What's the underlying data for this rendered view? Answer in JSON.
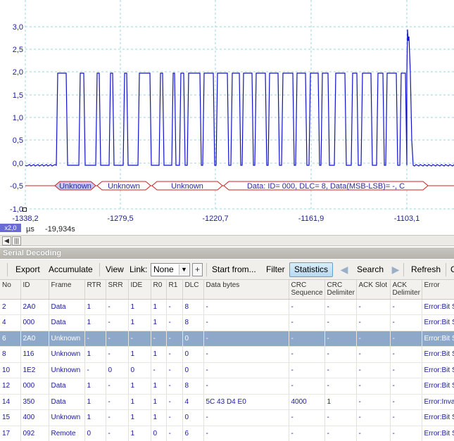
{
  "scope": {
    "y_ticks": [
      "3,0",
      "2,5",
      "2,0",
      "1,5",
      "1,0",
      "0,5",
      "0,0",
      "-0,5",
      "-1,0"
    ],
    "x_ticks": [
      "-1338,2",
      "-1279,5",
      "-1220,7",
      "-1161,9",
      "-1103,1"
    ],
    "zoom_badge": "x2,0",
    "unit": "µs",
    "time_offset": "-19,934s",
    "bus_labels": [
      "Unknown",
      "Unknown",
      "Unknown",
      "Data: ID= 000, DLC= 8, Data(MSB-LSB)= -, C"
    ],
    "colors": {
      "trace": "#1010c8",
      "grid": "#9fd4dc",
      "bus": "#d02020",
      "accent": "#6b6bd6"
    }
  },
  "panel": {
    "title": "Serial Decoding"
  },
  "toolbar": {
    "export": "Export",
    "accumulate": "Accumulate",
    "view": "View",
    "link_label": "Link:",
    "link_value": "None",
    "add": "+",
    "start_from": "Start from...",
    "filter": "Filter",
    "statistics": "Statistics",
    "search": "Search",
    "refresh": "Refresh",
    "more": "C"
  },
  "table": {
    "columns": [
      "No",
      "ID",
      "Frame",
      "RTR",
      "SRR",
      "IDE",
      "R0",
      "R1",
      "DLC",
      "Data bytes",
      "CRC Sequence",
      "CRC Delimiter",
      "ACK Slot",
      "ACK Delimiter",
      "Error"
    ],
    "rows": [
      [
        "2",
        "2A0",
        "Data",
        "1",
        "-",
        "1",
        "1",
        "-",
        "8",
        "-",
        "-",
        "-",
        "-",
        "-",
        "Error:Bit S"
      ],
      [
        "4",
        "000",
        "Data",
        "1",
        "-",
        "1",
        "1",
        "-",
        "8",
        "-",
        "-",
        "-",
        "-",
        "-",
        "Error:Bit S"
      ],
      [
        "6",
        "2A0",
        "Unknown",
        "-",
        "-",
        "-",
        "-",
        "-",
        "0",
        "-",
        "-",
        "-",
        "-",
        "-",
        "Error:Bit S"
      ],
      [
        "8",
        "116",
        "Unknown",
        "1",
        "-",
        "1",
        "1",
        "-",
        "0",
        "-",
        "-",
        "-",
        "-",
        "-",
        "Error:Bit S"
      ],
      [
        "10",
        "1E2",
        "Unknown",
        "-",
        "0",
        "0",
        "-",
        "-",
        "0",
        "-",
        "-",
        "-",
        "-",
        "-",
        "Error:Bit S"
      ],
      [
        "12",
        "000",
        "Data",
        "1",
        "-",
        "1",
        "1",
        "-",
        "8",
        "-",
        "-",
        "-",
        "-",
        "-",
        "Error:Bit S"
      ],
      [
        "14",
        "350",
        "Data",
        "1",
        "-",
        "1",
        "1",
        "-",
        "4",
        "5C 43 D4 E0",
        "4000",
        "1",
        "-",
        "-",
        "Error:Inva"
      ],
      [
        "15",
        "400",
        "Unknown",
        "1",
        "-",
        "1",
        "1",
        "-",
        "0",
        "-",
        "-",
        "-",
        "-",
        "-",
        "Error:Bit S"
      ],
      [
        "17",
        "092",
        "Remote",
        "0",
        "-",
        "1",
        "0",
        "-",
        "6",
        "-",
        "-",
        "-",
        "-",
        "-",
        "Error:Bit S"
      ]
    ],
    "selected_row": 2
  }
}
